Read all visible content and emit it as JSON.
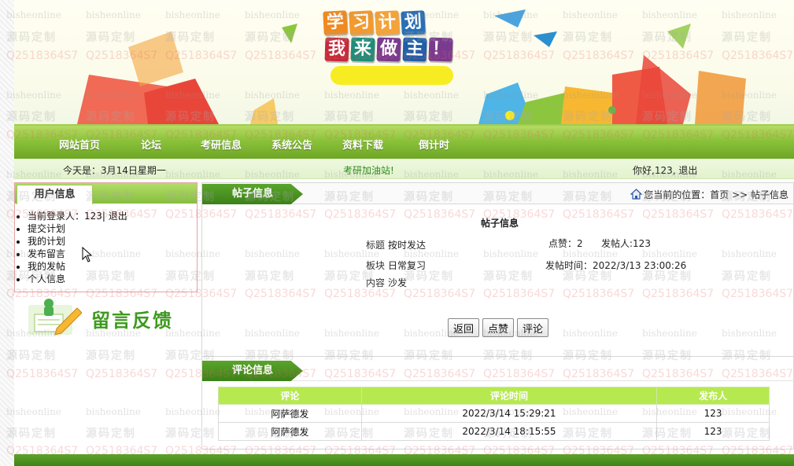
{
  "banner": {
    "title_line1": [
      "学",
      "习",
      "计",
      "划"
    ],
    "title_line2": [
      "我",
      "来",
      "做",
      "主",
      "！"
    ],
    "colors": {
      "line1": [
        "#f08a1e",
        "#f29a2e",
        "#f4a23a",
        "#2a6fb5"
      ],
      "line2": [
        "#c52a3b",
        "#1e8d7a",
        "#7a3b8f",
        "#1f5ea8",
        "#7a3b8f"
      ],
      "yellow": "#f7ec21"
    }
  },
  "nav": {
    "items": [
      "网站首页",
      "论坛",
      "考研信息",
      "系统公告",
      "资料下载",
      "倒计时"
    ],
    "colors": {
      "bar_top": "#b4dc62",
      "bar_bottom": "#6ea626"
    }
  },
  "infobar": {
    "date": "今天是：3月14日星期一",
    "slogan": "考研加油站!",
    "greeting": "你好,123, 退出"
  },
  "user_panel": {
    "title": "用户信息",
    "items": [
      "当前登录人：123| 退出",
      "提交计划",
      "我的计划",
      "发布留言",
      "我的发帖",
      "个人信息"
    ]
  },
  "feedback": {
    "label": "留言反馈"
  },
  "post_panel": {
    "tab": "帖子信息",
    "breadcrumb": "您当前的位置：首页 >> 帖子信息",
    "detail_title": "帖子信息",
    "fields": {
      "title_label": "标题",
      "title_value": "按时发达",
      "likes": "点赞：2",
      "poster": "发帖人:123",
      "board_label": "板块",
      "board_value": "日常复习",
      "post_time": "发帖时间：2022/3/13 23:00:26",
      "content_label": "内容",
      "content_value": "沙发"
    },
    "buttons": {
      "back": "返回",
      "like": "点赞",
      "comment": "评论"
    }
  },
  "comment_panel": {
    "tab": "评论信息",
    "columns": [
      "评论",
      "评论时间",
      "发布人"
    ],
    "rows": [
      [
        "阿萨德发",
        "2022/3/14 15:29:21",
        "123"
      ],
      [
        "阿萨德发",
        "2022/3/14 18:15:55",
        "123"
      ]
    ]
  },
  "watermark": {
    "text_a": "bisheonline",
    "text_b": "源码定制",
    "text_c": "Q2518364S7"
  }
}
